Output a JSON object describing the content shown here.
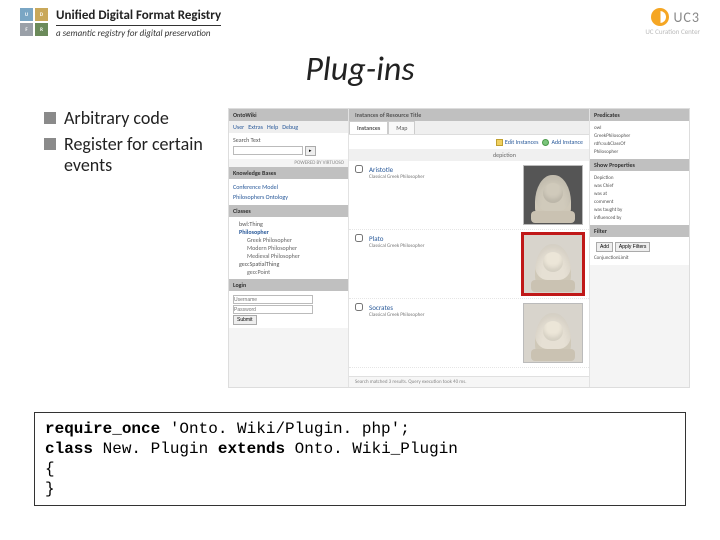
{
  "header": {
    "title": "Unified Digital Format Registry",
    "subtitle": "a semantic registry for digital preservation",
    "logo_letters": [
      "U",
      "D",
      "F",
      "R"
    ],
    "uc3_label": "UC3",
    "uc3_sub": "UC Curation Center"
  },
  "slide_title": "Plug-ins",
  "bullets": [
    "Arbitrary code",
    "Register for certain events"
  ],
  "screenshot": {
    "left": {
      "ontowiki": {
        "label": "OntoWiki",
        "nav": [
          "User",
          "Extras",
          "Help",
          "Debug"
        ]
      },
      "search": {
        "label": "Search Text",
        "placeholder": "",
        "powered": "POWERED BY VIRTUOSO"
      },
      "kb": {
        "header": "Knowledge Bases",
        "items": [
          "Conference Model",
          "Philosophers Ontology"
        ]
      },
      "classes": {
        "header": "Classes",
        "tree": [
          {
            "label": "bwl:Thing",
            "lvl": 0
          },
          {
            "label": "Philosopher",
            "lvl": 1,
            "sel": true
          },
          {
            "label": "Greek Philosopher",
            "lvl": 2
          },
          {
            "label": "Modern Philosopher",
            "lvl": 2
          },
          {
            "label": "Medieval Philosopher",
            "lvl": 2
          },
          {
            "label": "geo:SpatialThing",
            "lvl": 1
          },
          {
            "label": "geo:Point",
            "lvl": 2
          }
        ]
      },
      "login": {
        "header": "Login",
        "fields": [
          "Username",
          "Password"
        ],
        "submit": "Submit"
      }
    },
    "main": {
      "header": "Instances of Resource Title",
      "tabs": [
        "Instances",
        "Map"
      ],
      "toolbar": {
        "edit": "Edit Instances",
        "add": "Add Instance"
      },
      "columns": [
        "",
        "",
        "depiction"
      ],
      "rows": [
        {
          "name": "Aristotle",
          "desc": "Classical Greek Philosopher"
        },
        {
          "name": "Plato",
          "desc": "Classical Greek Philosopher"
        },
        {
          "name": "Socrates",
          "desc": "Classical Greek Philosopher"
        }
      ],
      "status": "Search matched 3 results.   Query execution took 40 ms."
    },
    "right": {
      "predicates": {
        "header": "Predicates",
        "items": [
          "owl",
          "GreekPhilosopher",
          "rdfs:subClassOf",
          "Philosopher"
        ]
      },
      "show": {
        "header": "Show Properties",
        "items": [
          "Depiction",
          "was Chief",
          "was at",
          "comment",
          "was taught by",
          "influenced by"
        ]
      },
      "filter": {
        "header": "Filter",
        "buttons": [
          "Add",
          "Apply Filters"
        ],
        "note": "ConjunctionLimit"
      }
    }
  },
  "code": {
    "l1a": "require_once",
    "l1b": " 'Onto. Wiki/Plugin. php';",
    "l2a": "class",
    "l2b": " New. Plugin ",
    "l2c": "extends",
    "l2d": " Onto. Wiki_Plugin",
    "l3": "{",
    "l4": "}"
  }
}
